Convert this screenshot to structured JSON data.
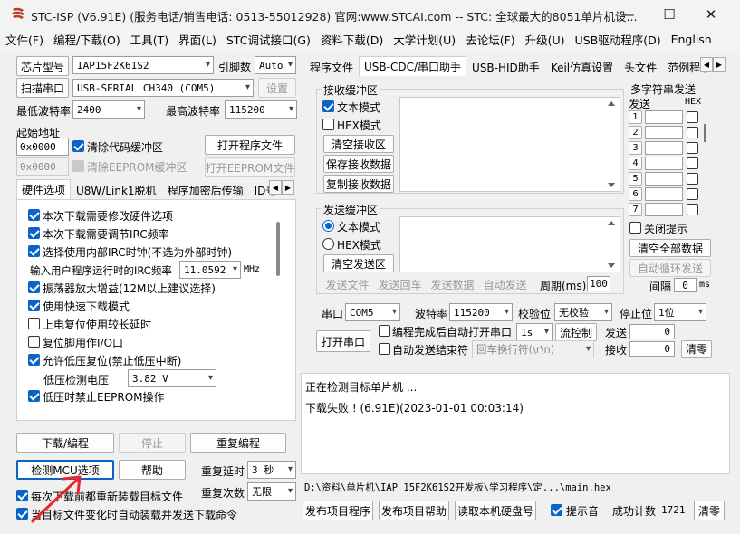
{
  "window": {
    "title": "STC-ISP (V6.91E) (服务电话/销售电话: 0513-55012928) 官网:www.STCAI.com  -- STC: 全球最大的8051单片机设...",
    "minimize": "—",
    "maximize": "☐",
    "close": "✕"
  },
  "menu": [
    "文件(F)",
    "编程/下载(O)",
    "工具(T)",
    "界面(L)",
    "STC调试接口(G)",
    "资料下载(D)",
    "大学计划(U)",
    "去论坛(F)",
    "升级(U)",
    "USB驱动程序(D)",
    "English"
  ],
  "left": {
    "chip_button": "芯片型号",
    "chip_value": "IAP15F2K61S2",
    "pin_label": "引脚数",
    "pin_value": "Auto",
    "scan_button": "扫描串口",
    "port_value": "USB-SERIAL CH340 (COM5)",
    "settings_button": "设置",
    "min_baud_label": "最低波特率",
    "min_baud_value": "2400",
    "max_baud_label": "最高波特率",
    "max_baud_value": "115200",
    "start_addr_label": "起始地址",
    "code_addr": "0x0000",
    "clear_code_label": "清除代码缓冲区",
    "open_program_button": "打开程序文件",
    "eeprom_addr": "0x0000",
    "clear_eeprom_label": "清除EEPROM缓冲区",
    "open_eeprom_button": "打开EEPROM文件",
    "tabs": [
      "硬件选项",
      "U8W/Link1脱机",
      "程序加密后传输",
      "ID号"
    ],
    "hw_options": [
      "本次下载需要修改硬件选项",
      "本次下载需要调节IRC频率",
      "选择使用内部IRC时钟(不选为外部时钟)",
      "振荡器放大增益(12M以上建议选择)",
      "使用快速下载模式",
      "上电复位使用较长延时",
      "复位脚用作I/O口",
      "允许低压复位(禁止低压中断)",
      "低压时禁止EEPROM操作"
    ],
    "irc_label": "输入用户程序运行时的IRC频率",
    "irc_value": "11.0592",
    "irc_unit": "MHz",
    "lvd_label": "低压检测电压",
    "lvd_value": "3.82 V",
    "download_button": "下载/编程",
    "stop_button": "停止",
    "reprogram_button": "重复编程",
    "detect_button": "检测MCU选项",
    "help_button": "帮助",
    "repeat_delay_label": "重复延时",
    "repeat_delay_value": "3 秒",
    "repeat_count_label": "重复次数",
    "repeat_count_value": "无限",
    "reload_label": "每次下载前都重新装载目标文件",
    "auto_send_label": "当目标文件变化时自动装载并发送下载命令"
  },
  "right": {
    "tabs": [
      "程序文件",
      "USB-CDC/串口助手",
      "USB-HID助手",
      "Keil仿真设置",
      "头文件",
      "范例程序"
    ],
    "recv_group": "接收缓冲区",
    "recv_text_mode": "文本模式",
    "recv_hex_mode": "HEX模式",
    "clear_recv": "清空接收区",
    "save_recv": "保存接收数据",
    "copy_recv": "复制接收数据",
    "send_group": "发送缓冲区",
    "send_text_mode": "文本模式",
    "send_hex_mode": "HEX模式",
    "clear_send": "清空发送区",
    "multi_title": "多字符串发送",
    "multi_send_col": "发送",
    "multi_hex_col": "HEX",
    "multi_rows": [
      "1",
      "2",
      "3",
      "4",
      "5",
      "6",
      "7"
    ],
    "close_hint": "关闭提示",
    "clear_all": "清空全部数据",
    "auto_cycle": "自动循环发送",
    "interval_label": "间隔",
    "interval_value": "0",
    "interval_unit": "ms",
    "send_file": "发送文件",
    "send_enter": "发送回车",
    "send_data": "发送数据",
    "auto_send": "自动发送",
    "period_label": "周期(ms)",
    "period_value": "100",
    "port_label": "串口",
    "port_value": "COM5",
    "baud_label": "波特率",
    "baud_value": "115200",
    "parity_label": "校验位",
    "parity_value": "无校验",
    "stop_label": "停止位",
    "stop_value": "1位",
    "open_port": "打开串口",
    "auto_open_label": "编程完成后自动打开串口",
    "auto_open_value": "1s",
    "flow_control": "流控制",
    "auto_send_end": "自动发送结束符",
    "newline_label": "回车换行符(\\r\\n)",
    "send_count_label": "发送",
    "send_count": "0",
    "recv_count_label": "接收",
    "recv_count": "0",
    "clear_count": "清零",
    "log": [
      "正在检测目标单片机 ...",
      "下载失败 ! (6.91E)(2023-01-01 00:03:14)"
    ],
    "path": "D:\\资料\\单片机\\IAP 15F2K61S2开发板\\学习程序\\定...\\main.hex",
    "publish_program": "发布项目程序",
    "publish_help": "发布项目帮助",
    "read_disk": "读取本机硬盘号",
    "beep_label": "提示音",
    "success_label": "成功计数",
    "success_count": "1721",
    "clear_success": "清零"
  }
}
